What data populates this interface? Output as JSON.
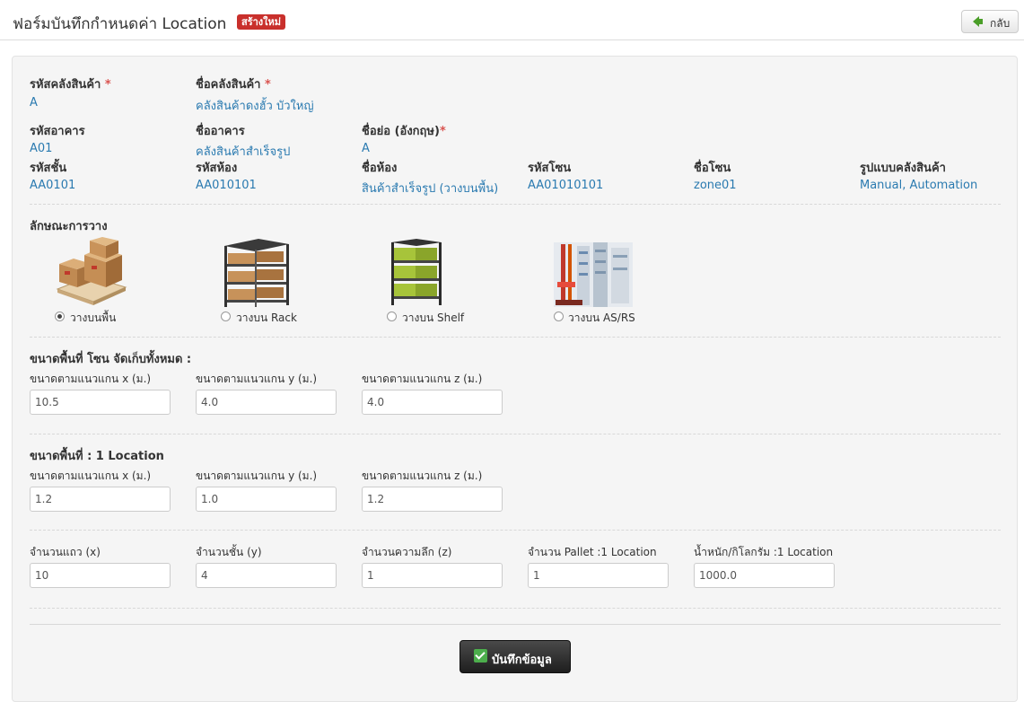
{
  "header": {
    "title": "ฟอร์มบันทึกกำหนดค่า Location",
    "badge": "สร้างใหม่",
    "back_label": "กลับ"
  },
  "warehouse": {
    "code_label": "รหัสคลังสินค้า",
    "code_value": "A",
    "name_label": "ชื่อคลังสินค้า",
    "name_value": "คลังสินค้าดงฮั้ว บัวใหญ่",
    "required_mark": "*"
  },
  "building": {
    "code_label": "รหัสอาคาร",
    "code_value": "A01",
    "name_label": "ชื่ออาคาร",
    "name_value": "คลังสินค้าสำเร็จรูป",
    "abbr_label": "ชื่อย่อ (อังกฤษ)",
    "abbr_value": "A"
  },
  "floor": {
    "floor_code_label": "รหัสชั้น",
    "floor_code_value": "AA0101",
    "room_code_label": "รหัสห้อง",
    "room_code_value": "AA010101",
    "room_name_label": "ชื่อห้อง",
    "room_name_value": "สินค้าสำเร็จรูป (วางบนพื้น)",
    "zone_code_label": "รหัสโซน",
    "zone_code_value": "AA01010101",
    "zone_name_label": "ชื่อโซน",
    "zone_name_value": "zone01",
    "type_label": "รูปแบบคลังสินค้า",
    "type_value": "Manual, Automation"
  },
  "placement": {
    "label": "ลักษณะการวาง",
    "options": [
      {
        "label": "วางบนพื้น",
        "icon": "floor-pallet-icon",
        "selected": true
      },
      {
        "label": "วางบน Rack",
        "icon": "rack-icon",
        "selected": false
      },
      {
        "label": "วางบน Shelf",
        "icon": "shelf-icon",
        "selected": false
      },
      {
        "label": "วางบน AS/RS",
        "icon": "asrs-icon",
        "selected": false
      }
    ]
  },
  "zone_size": {
    "label": "ขนาดพื้นที่ โซน จัดเก็บทั้งหมด :",
    "x_label": "ขนาดตามแนวแกน x (ม.)",
    "x_value": "10.5",
    "y_label": "ขนาดตามแนวแกน y (ม.)",
    "y_value": "4.0",
    "z_label": "ขนาดตามแนวแกน z (ม.)",
    "z_value": "4.0"
  },
  "location_size": {
    "label": "ขนาดพื้นที่ : 1 Location",
    "x_label": "ขนาดตามแนวแกน x (ม.)",
    "x_value": "1.2",
    "y_label": "ขนาดตามแนวแกน y (ม.)",
    "y_value": "1.0",
    "z_label": "ขนาดตามแนวแกน z (ม.)",
    "z_value": "1.2"
  },
  "counts": {
    "rows_label": "จำนวนแถว (x)",
    "rows_value": "10",
    "levels_label": "จำนวนชั้น (y)",
    "levels_value": "4",
    "depth_label": "จำนวนความลึก (z)",
    "depth_value": "1",
    "pallet_label": "จำนวน Pallet :1 Location",
    "pallet_value": "1",
    "weight_label": "น้ำหนัก/กิโลกรัม :1 Location",
    "weight_value": "1000.0"
  },
  "actions": {
    "save_label": "บันทึกข้อมูล"
  },
  "colors": {
    "link_value": "#2a7ab0",
    "badge": "#c9302c",
    "save_button": "#2a2a2a",
    "check_green": "#4cae4c"
  }
}
